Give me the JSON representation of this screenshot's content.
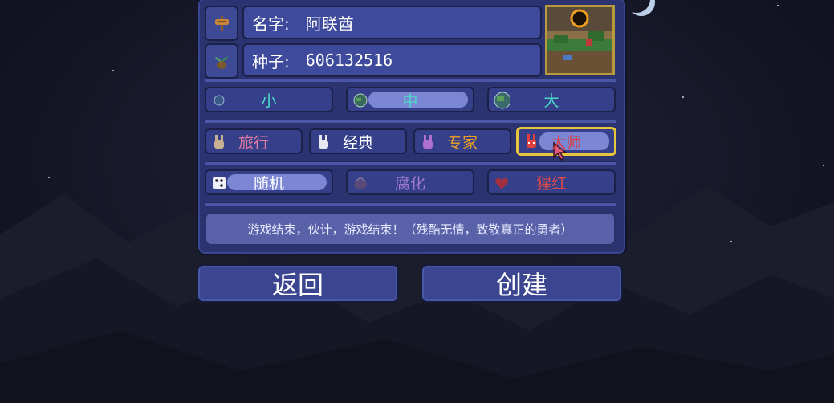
{
  "world_create": {
    "name_label": "名字:",
    "name_value": "阿联酋",
    "seed_label": "种子:",
    "seed_value": "606132516",
    "sizes": [
      "小",
      "中",
      "大"
    ],
    "selected_size": "中",
    "difficulties": [
      "旅行",
      "经典",
      "专家",
      "大师"
    ],
    "selected_difficulty": "大师",
    "evils": [
      "随机",
      "腐化",
      "猩红"
    ],
    "selected_evil": "随机",
    "description": "游戏结束，伙计，游戏结束！（残酷无情，致敬真正的勇者）",
    "back_label": "返回",
    "create_label": "创建"
  },
  "colors": {
    "size_text": "#4cd9c8",
    "journey_text": "#e07aa0",
    "classic_text": "#ffffff",
    "expert_text": "#f0a020",
    "master_text": "#e03a3a",
    "random_text": "#ffffff",
    "corruption_text": "#a07ad0",
    "crimson_text": "#e04a4a",
    "panel": "#2b3470",
    "selected_border": "#e8c53a"
  },
  "icons": {
    "name_icon": "signpost-icon",
    "seed_icon": "sapling-icon",
    "small_icon": "small-world-icon",
    "medium_icon": "medium-world-icon",
    "large_icon": "large-world-icon",
    "journey_icon": "bunny-icon",
    "classic_icon": "bunny-icon",
    "expert_icon": "bunny-icon",
    "master_icon": "bunny-icon",
    "random_icon": "dice-icon",
    "corruption_icon": "corruption-icon",
    "crimson_icon": "crimson-heart-icon"
  }
}
